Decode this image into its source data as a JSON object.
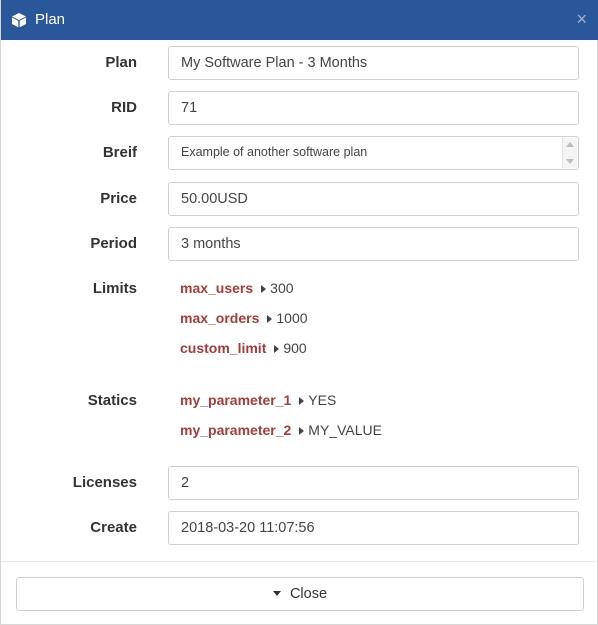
{
  "window": {
    "title": "Plan",
    "close_glyph": "×"
  },
  "form": {
    "plan": {
      "label": "Plan",
      "value": "My Software Plan - 3 Months"
    },
    "rid": {
      "label": "RID",
      "value": "71"
    },
    "brief": {
      "label": "Breif",
      "value": "Example of another software plan"
    },
    "price": {
      "label": "Price",
      "value": "50.00USD"
    },
    "period": {
      "label": "Period",
      "value": "3 months"
    },
    "limits": {
      "label": "Limits",
      "items": [
        {
          "key": "max_users",
          "value": "300"
        },
        {
          "key": "max_orders",
          "value": "1000"
        },
        {
          "key": "custom_limit",
          "value": "900"
        }
      ]
    },
    "statics": {
      "label": "Statics",
      "items": [
        {
          "key": "my_parameter_1",
          "value": "YES"
        },
        {
          "key": "my_parameter_2",
          "value": "MY_VALUE"
        }
      ]
    },
    "licenses": {
      "label": "Licenses",
      "value": "2"
    },
    "create": {
      "label": "Create",
      "value": "2018-03-20 11:07:56"
    }
  },
  "footer": {
    "close_label": "Close"
  },
  "icons": {
    "title_icon": "cube-icon",
    "close_icon": "close-icon",
    "button_icon": "caret-down-icon",
    "item_icon": "caret-right-icon"
  },
  "colors": {
    "titlebar": "#2a579a",
    "key_text": "#a03d3d"
  }
}
